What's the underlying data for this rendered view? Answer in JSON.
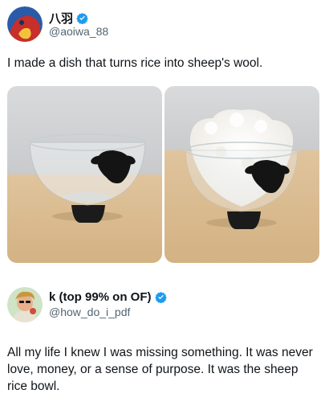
{
  "post1": {
    "display_name": "八羽",
    "handle": "@aoiwa_88",
    "text": "I made a dish that turns rice into sheep's wool.",
    "verified": true,
    "verified_color": "#1d9bf0",
    "photos": [
      "empty-glass-sheep-bowl",
      "rice-filled-sheep-bowl"
    ]
  },
  "post2": {
    "display_name": "k (top 99% on OF)",
    "handle": "@how_do_i_pdf",
    "text": "All my life I knew I was missing something. It was never love, money, or a sense of purpose. It was the sheep rice bowl.",
    "verified": true,
    "verified_color": "#1d9bf0"
  }
}
